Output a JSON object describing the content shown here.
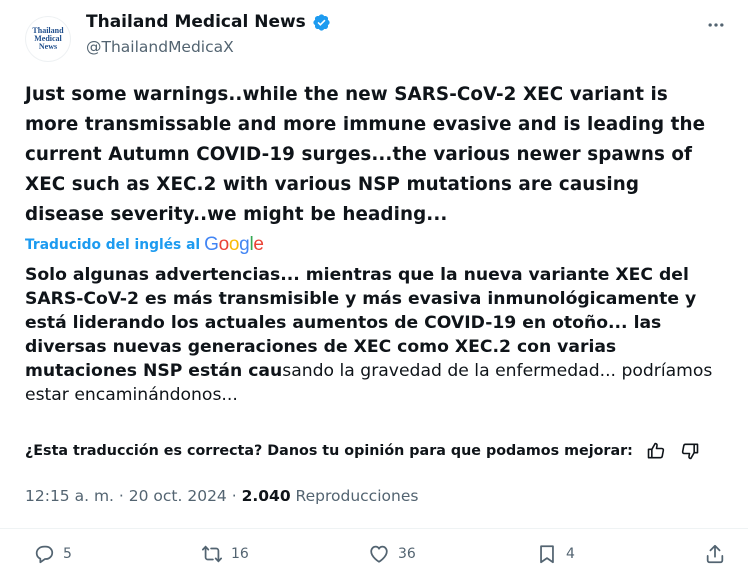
{
  "account": {
    "avatar_text": [
      "Thailand",
      "Medical",
      "News"
    ],
    "display_name": "Thailand Medical News",
    "handle": "@ThailandMedicaX"
  },
  "tweet": {
    "text": "Just some warnings..while the new SARS-CoV-2 XEC variant is more transmissable and more immune evasive and is leading the current Autumn COVID-19 surges...the various newer spawns of XEC such as XEC.2 with various NSP mutations are causing disease severity..we might be heading..."
  },
  "translation": {
    "label": "Traducido del inglés al",
    "provider": "Google",
    "text_bold": "Solo algunas advertencias... mientras que la nueva variante XEC del SARS-CoV-2 es más transmisible y más evasiva inmunológicamente y está liderando los actuales aumentos de COVID-19 en otoño... las diversas nuevas generaciones de XEC como XEC.2 con varias mutaciones NSP están cau",
    "text_normal": "sando la gravedad de la enfermedad... podríamos estar encaminándonos...",
    "feedback_prompt": "¿Esta traducción es correcta? Danos tu opinión para que podamos mejorar:"
  },
  "meta": {
    "time_date": "12:15 a. m. · 20 oct. 2024 · ",
    "views_count": "2.040",
    "views_label": " Reproducciones"
  },
  "actions": {
    "replies": "5",
    "reposts": "16",
    "likes": "36",
    "bookmarks": "4"
  },
  "colors": {
    "accent": "#1d9bf0",
    "secondary_text": "#536471",
    "icon": "#536471"
  }
}
